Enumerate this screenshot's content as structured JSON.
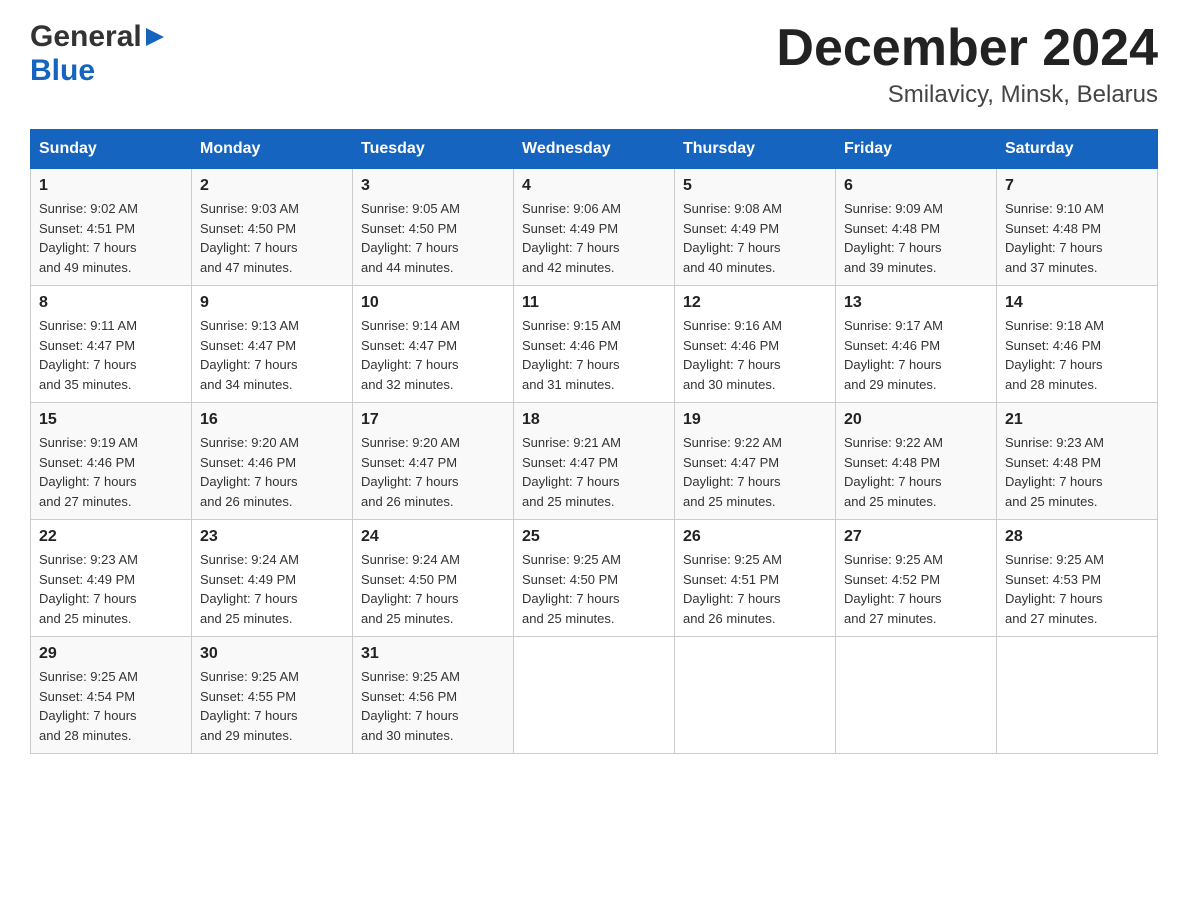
{
  "header": {
    "logo_general": "General",
    "logo_blue": "Blue",
    "month_title": "December 2024",
    "subtitle": "Smilavicy, Minsk, Belarus"
  },
  "days_of_week": [
    "Sunday",
    "Monday",
    "Tuesday",
    "Wednesday",
    "Thursday",
    "Friday",
    "Saturday"
  ],
  "weeks": [
    [
      {
        "day": "1",
        "sunrise": "9:02 AM",
        "sunset": "4:51 PM",
        "daylight": "7 hours and 49 minutes."
      },
      {
        "day": "2",
        "sunrise": "9:03 AM",
        "sunset": "4:50 PM",
        "daylight": "7 hours and 47 minutes."
      },
      {
        "day": "3",
        "sunrise": "9:05 AM",
        "sunset": "4:50 PM",
        "daylight": "7 hours and 44 minutes."
      },
      {
        "day": "4",
        "sunrise": "9:06 AM",
        "sunset": "4:49 PM",
        "daylight": "7 hours and 42 minutes."
      },
      {
        "day": "5",
        "sunrise": "9:08 AM",
        "sunset": "4:49 PM",
        "daylight": "7 hours and 40 minutes."
      },
      {
        "day": "6",
        "sunrise": "9:09 AM",
        "sunset": "4:48 PM",
        "daylight": "7 hours and 39 minutes."
      },
      {
        "day": "7",
        "sunrise": "9:10 AM",
        "sunset": "4:48 PM",
        "daylight": "7 hours and 37 minutes."
      }
    ],
    [
      {
        "day": "8",
        "sunrise": "9:11 AM",
        "sunset": "4:47 PM",
        "daylight": "7 hours and 35 minutes."
      },
      {
        "day": "9",
        "sunrise": "9:13 AM",
        "sunset": "4:47 PM",
        "daylight": "7 hours and 34 minutes."
      },
      {
        "day": "10",
        "sunrise": "9:14 AM",
        "sunset": "4:47 PM",
        "daylight": "7 hours and 32 minutes."
      },
      {
        "day": "11",
        "sunrise": "9:15 AM",
        "sunset": "4:46 PM",
        "daylight": "7 hours and 31 minutes."
      },
      {
        "day": "12",
        "sunrise": "9:16 AM",
        "sunset": "4:46 PM",
        "daylight": "7 hours and 30 minutes."
      },
      {
        "day": "13",
        "sunrise": "9:17 AM",
        "sunset": "4:46 PM",
        "daylight": "7 hours and 29 minutes."
      },
      {
        "day": "14",
        "sunrise": "9:18 AM",
        "sunset": "4:46 PM",
        "daylight": "7 hours and 28 minutes."
      }
    ],
    [
      {
        "day": "15",
        "sunrise": "9:19 AM",
        "sunset": "4:46 PM",
        "daylight": "7 hours and 27 minutes."
      },
      {
        "day": "16",
        "sunrise": "9:20 AM",
        "sunset": "4:46 PM",
        "daylight": "7 hours and 26 minutes."
      },
      {
        "day": "17",
        "sunrise": "9:20 AM",
        "sunset": "4:47 PM",
        "daylight": "7 hours and 26 minutes."
      },
      {
        "day": "18",
        "sunrise": "9:21 AM",
        "sunset": "4:47 PM",
        "daylight": "7 hours and 25 minutes."
      },
      {
        "day": "19",
        "sunrise": "9:22 AM",
        "sunset": "4:47 PM",
        "daylight": "7 hours and 25 minutes."
      },
      {
        "day": "20",
        "sunrise": "9:22 AM",
        "sunset": "4:48 PM",
        "daylight": "7 hours and 25 minutes."
      },
      {
        "day": "21",
        "sunrise": "9:23 AM",
        "sunset": "4:48 PM",
        "daylight": "7 hours and 25 minutes."
      }
    ],
    [
      {
        "day": "22",
        "sunrise": "9:23 AM",
        "sunset": "4:49 PM",
        "daylight": "7 hours and 25 minutes."
      },
      {
        "day": "23",
        "sunrise": "9:24 AM",
        "sunset": "4:49 PM",
        "daylight": "7 hours and 25 minutes."
      },
      {
        "day": "24",
        "sunrise": "9:24 AM",
        "sunset": "4:50 PM",
        "daylight": "7 hours and 25 minutes."
      },
      {
        "day": "25",
        "sunrise": "9:25 AM",
        "sunset": "4:50 PM",
        "daylight": "7 hours and 25 minutes."
      },
      {
        "day": "26",
        "sunrise": "9:25 AM",
        "sunset": "4:51 PM",
        "daylight": "7 hours and 26 minutes."
      },
      {
        "day": "27",
        "sunrise": "9:25 AM",
        "sunset": "4:52 PM",
        "daylight": "7 hours and 27 minutes."
      },
      {
        "day": "28",
        "sunrise": "9:25 AM",
        "sunset": "4:53 PM",
        "daylight": "7 hours and 27 minutes."
      }
    ],
    [
      {
        "day": "29",
        "sunrise": "9:25 AM",
        "sunset": "4:54 PM",
        "daylight": "7 hours and 28 minutes."
      },
      {
        "day": "30",
        "sunrise": "9:25 AM",
        "sunset": "4:55 PM",
        "daylight": "7 hours and 29 minutes."
      },
      {
        "day": "31",
        "sunrise": "9:25 AM",
        "sunset": "4:56 PM",
        "daylight": "7 hours and 30 minutes."
      },
      null,
      null,
      null,
      null
    ]
  ],
  "labels": {
    "sunrise": "Sunrise:",
    "sunset": "Sunset:",
    "daylight": "Daylight:"
  }
}
